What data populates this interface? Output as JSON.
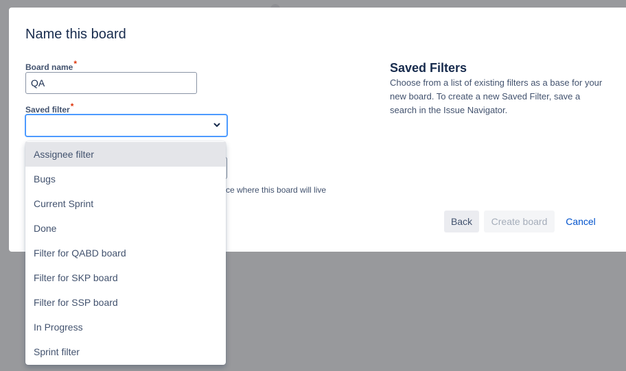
{
  "dialog": {
    "title": "Name this board"
  },
  "form": {
    "board_name": {
      "label": "Board name",
      "required_marker": "*",
      "value": "QA"
    },
    "saved_filter": {
      "label": "Saved filter",
      "required_marker": "*",
      "value": "",
      "chevron_icon": "chevron-down-icon"
    },
    "location_helper_partial": "ce where this board will live"
  },
  "info": {
    "title": "Saved Filters",
    "text": "Choose from a list of existing filters as a base for your new board. To create a new Saved Filter, save a search in the Issue Navigator."
  },
  "buttons": {
    "back": "Back",
    "create": "Create board",
    "cancel": "Cancel"
  },
  "dropdown": {
    "highlighted_index": 0,
    "options": [
      "Assignee filter",
      "Bugs",
      "Current Sprint",
      "Done",
      "Filter for QABD board",
      "Filter for SKP board",
      "Filter for SSP board",
      "In Progress",
      "Sprint filter"
    ]
  },
  "colors": {
    "focus_border": "#4c9aff",
    "required": "#de350b",
    "link": "#0052cc",
    "overlay": "#98999c"
  }
}
